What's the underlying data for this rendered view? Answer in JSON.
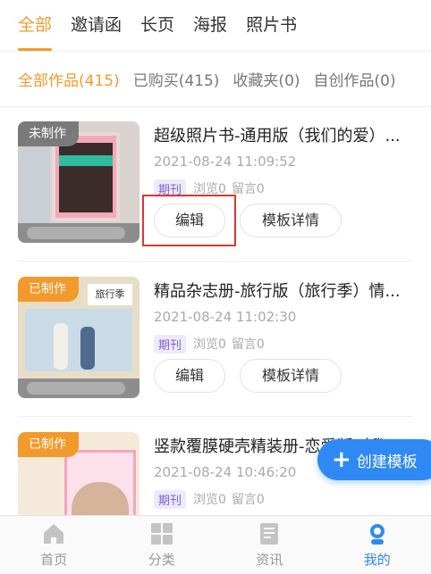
{
  "tabs": [
    "全部",
    "邀请函",
    "长页",
    "海报",
    "照片书"
  ],
  "filters": [
    "全部作品(415)",
    "已购买(415)",
    "收藏夹(0)",
    "自创作品(0)"
  ],
  "cards": [
    {
      "badge": "未制作",
      "title": "超级照片书-通用版（我们的爱）...",
      "date": "2021-08-24 11:09:52",
      "tag": "期刊",
      "views": "浏览0",
      "comments": "留言0",
      "edit": "编辑",
      "detail": "模板详情"
    },
    {
      "badge": "已制作",
      "thumb_head": "旅行季",
      "title": "精品杂志册-旅行版（旅行季）情...",
      "date": "2021-08-24 11:02:30",
      "tag": "期刊",
      "views": "浏览0",
      "comments": "留言0",
      "edit": "编辑",
      "detail": "模板详情"
    },
    {
      "badge": "已制作",
      "title": "竖款覆膜硬壳精装册-恋爱版（我...",
      "date": "2021-08-24 10:46:20",
      "tag": "期刊",
      "views": "浏览0",
      "comments": "留言0"
    }
  ],
  "fab": {
    "icon": "+",
    "label": "创建模板"
  },
  "bottom_nav": [
    {
      "label": "首页",
      "icon": "home-icon"
    },
    {
      "label": "分类",
      "icon": "grid-icon"
    },
    {
      "label": "资讯",
      "icon": "document-icon"
    },
    {
      "label": "我的",
      "icon": "user-icon"
    }
  ],
  "colors": {
    "accent": "#f39a2c",
    "primary": "#2f89f5",
    "highlight": "#d9392c",
    "tag": "#7b64d6"
  }
}
